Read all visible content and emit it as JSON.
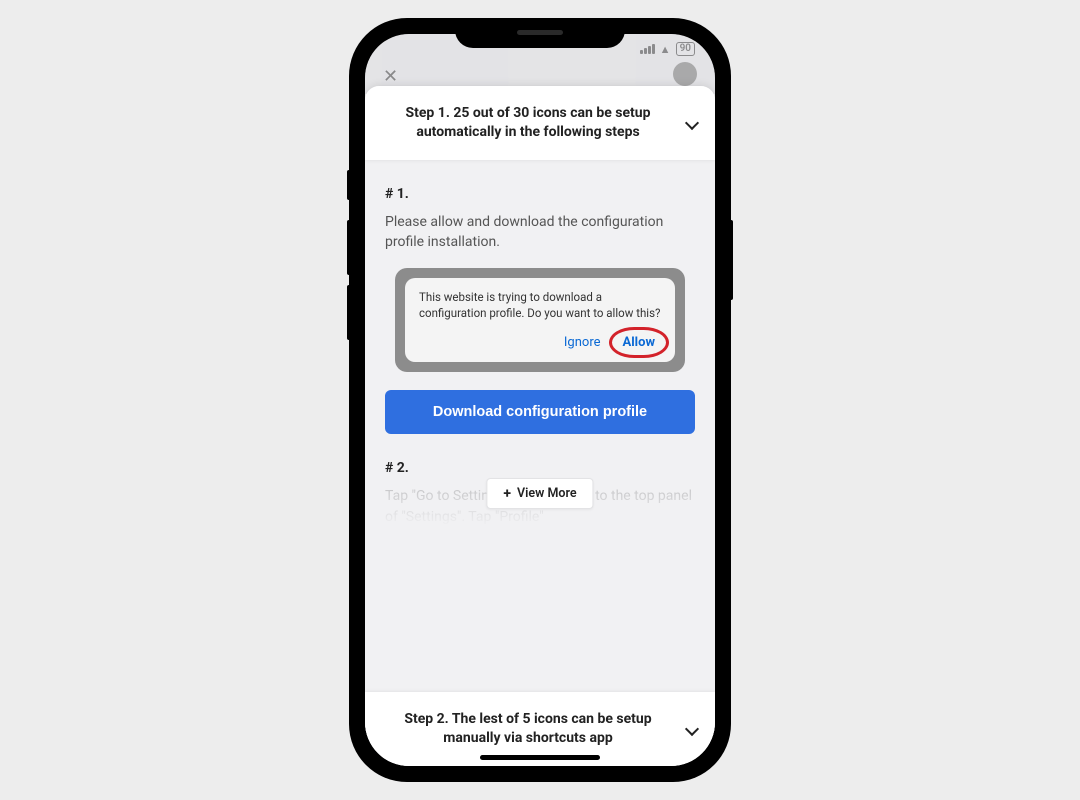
{
  "status": {
    "battery": "90"
  },
  "step1": {
    "header": "Step 1. 25 out of 30 icons can be setup automatically in the following steps",
    "item1_num": "# 1.",
    "item1_text": "Please allow and download the configuration profile installation.",
    "dialog_text": "This website is trying to download a configuration profile. Do you want to allow this?",
    "dialog_ignore": "Ignore",
    "dialog_allow": "Allow",
    "download_btn": "Download configuration profile",
    "item2_num": "# 2.",
    "item2_text": "Tap \"Go to Settings\" and navigate to the top panel of \"Settings\". Tap \"Profile\"",
    "view_more": "View More"
  },
  "step2": {
    "header": "Step 2. The lest of 5 icons can be setup manually via shortcuts app"
  }
}
